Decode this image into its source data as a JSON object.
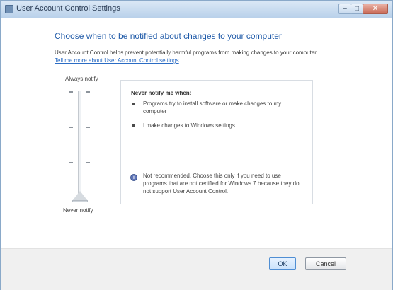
{
  "window": {
    "title": "User Account Control Settings",
    "buttons": {
      "minimize": "‒",
      "maximize": "□",
      "close": "✕"
    }
  },
  "content": {
    "heading": "Choose when to be notified about changes to your computer",
    "description": "User Account Control helps prevent potentially harmful programs from making changes to your computer.",
    "link_text": "Tell me more about User Account Control settings",
    "slider": {
      "top_label": "Always notify",
      "bottom_label": "Never notify",
      "level": 0
    },
    "panel": {
      "title": "Never notify me when:",
      "bullets": [
        "Programs try to install software or make changes to my computer",
        "I make changes to Windows settings"
      ],
      "note": "Not recommended. Choose this only if you need to use programs that are not certified for Windows 7 because they do not support User Account Control."
    }
  },
  "footer": {
    "ok_label": "OK",
    "cancel_label": "Cancel"
  }
}
